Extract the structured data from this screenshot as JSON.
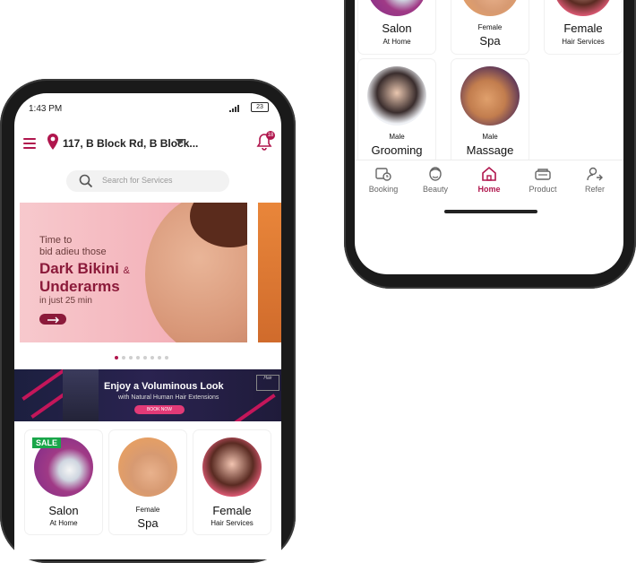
{
  "status": {
    "time": "1:43 PM",
    "battery": "23"
  },
  "header": {
    "address": "117, B Block Rd, B Block...",
    "notification_count": "18"
  },
  "search": {
    "placeholder": "Search for Services"
  },
  "banner": {
    "line1": "Time to",
    "line2": "bid adieu those",
    "line3": "Dark Bikini",
    "amp": "&",
    "line4": "Underarms",
    "line5": "in just 25 min",
    "slide_count": 8,
    "active_slide": 1
  },
  "promo": {
    "title": "Enjoy a Voluminous Look",
    "subtitle": "with Natural Human Hair Extensions",
    "button": "BOOK NOW",
    "brand": "Hair"
  },
  "categories": [
    {
      "id": "salon",
      "top": "",
      "title": "Salon",
      "subtitle": "At Home",
      "badge": "SALE"
    },
    {
      "id": "spa",
      "top": "Female",
      "title": "Spa",
      "subtitle": ""
    },
    {
      "id": "hair",
      "top": "",
      "title": "Female",
      "subtitle": "Hair Services"
    },
    {
      "id": "grooming",
      "top": "Male",
      "title": "Grooming",
      "subtitle": ""
    },
    {
      "id": "massage",
      "top": "Male",
      "title": "Massage",
      "subtitle": ""
    }
  ],
  "nav": [
    {
      "label": "Booking",
      "icon": "booking-icon"
    },
    {
      "label": "Beauty",
      "icon": "beauty-icon"
    },
    {
      "label": "Home",
      "icon": "home-icon",
      "active": true
    },
    {
      "label": "Product",
      "icon": "product-icon"
    },
    {
      "label": "Refer",
      "icon": "refer-icon"
    }
  ],
  "colors": {
    "brand": "#b0164d",
    "sale": "#1aa64a"
  }
}
